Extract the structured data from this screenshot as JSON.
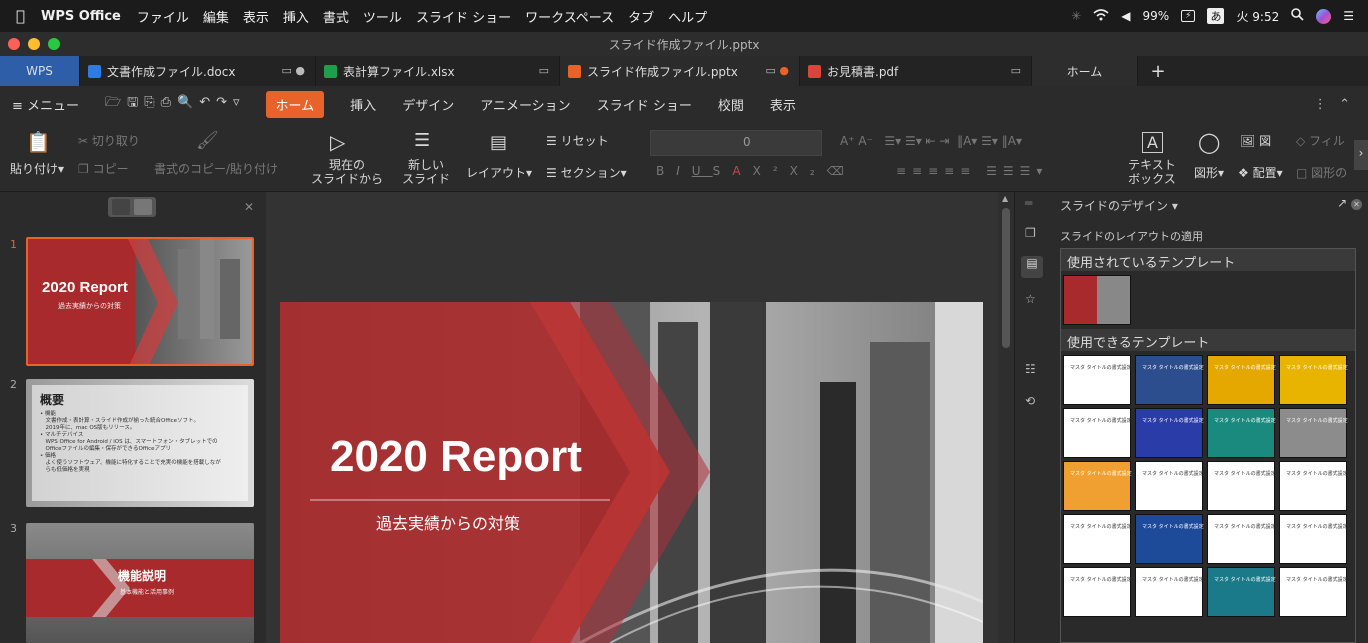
{
  "menubar": {
    "app": "WPS Office",
    "items": [
      "ファイル",
      "編集",
      "表示",
      "挿入",
      "書式",
      "ツール",
      "スライド ショー",
      "ワークスペース",
      "タブ",
      "ヘルプ"
    ],
    "battery": "99%",
    "ime": "あ",
    "clock": "火 9:52"
  },
  "window": {
    "title": "スライド作成ファイル.pptx"
  },
  "tabs": [
    {
      "label": "WPS"
    },
    {
      "label": "文書作成ファイル.docx",
      "color": "#2f7be0"
    },
    {
      "label": "表計算ファイル.xlsx",
      "color": "#1f9e4e"
    },
    {
      "label": "スライド作成ファイル.pptx",
      "color": "#e8632a"
    },
    {
      "label": "お見積書.pdf",
      "color": "#d8453b"
    },
    {
      "label": "ホーム"
    }
  ],
  "ribbon_tabs": {
    "menu": "メニュー",
    "home": "ホーム",
    "items": [
      "挿入",
      "デザイン",
      "アニメーション",
      "スライド ショー",
      "校閲",
      "表示"
    ]
  },
  "ribbon": {
    "paste": "貼り付け",
    "cut": "切り取り",
    "copy": "コピー",
    "format_copy": "書式のコピー/貼り付け",
    "from_current": [
      "現在の",
      "スライドから"
    ],
    "new_slide": [
      "新しい",
      "スライド"
    ],
    "layout": "レイアウト",
    "reset": "リセット",
    "section": "セクション",
    "font_size": "0",
    "textbox": [
      "テキスト",
      "ボックス"
    ],
    "shape": "図形",
    "arrange": "配置",
    "picture": "図",
    "fill": "フィル",
    "shape_outline": "図形の"
  },
  "slides_panel": {
    "slide1": {
      "num": "1",
      "title": "2020 Report",
      "subtitle": "過去実績からの対策"
    },
    "slide2": {
      "num": "2",
      "title": "概要",
      "lines": [
        "• 機能",
        "　文書作成・表計算・スライド作成が揃った統合Officeソフト。",
        "　2019年に、mac OS版もリリース。",
        "• マルチデバイス",
        "　WPS Office for Android / iOS は、スマートフォン・タブレットでの",
        "　Officeファイルの編集・保存ができるOfficeアプリ",
        "• 価格",
        "　よく使うソフトウェア、機能に特化することで充実の機能を搭載しなが",
        "　らも低価格を実現"
      ]
    },
    "slide3": {
      "num": "3",
      "title": "機能説明",
      "subtitle": "基本機能と活用事例"
    }
  },
  "main_slide": {
    "title": "2020 Report",
    "subtitle": "過去実績からの対策"
  },
  "right_panel": {
    "header": "スライドのデザイン",
    "subheader": "スライドのレイアウトの適用",
    "used_templates": "使用されているテンプレート",
    "available_templates": "使用できるテンプレート",
    "template_label": "マスタ タイトルの書式設定"
  },
  "template_colors": [
    "#ffffff",
    "#2d4e8e",
    "#e4a800",
    "#e8b400",
    "#ffffff",
    "#2a3ca8",
    "#1a8a7e",
    "#8c8c8c",
    "#f0a030",
    "#ffffff",
    "#ffffff",
    "#ffffff",
    "#ffffff",
    "#1e4a9a",
    "#ffffff",
    "#ffffff",
    "#ffffff",
    "#ffffff",
    "#1a7a8a",
    "#ffffff"
  ]
}
